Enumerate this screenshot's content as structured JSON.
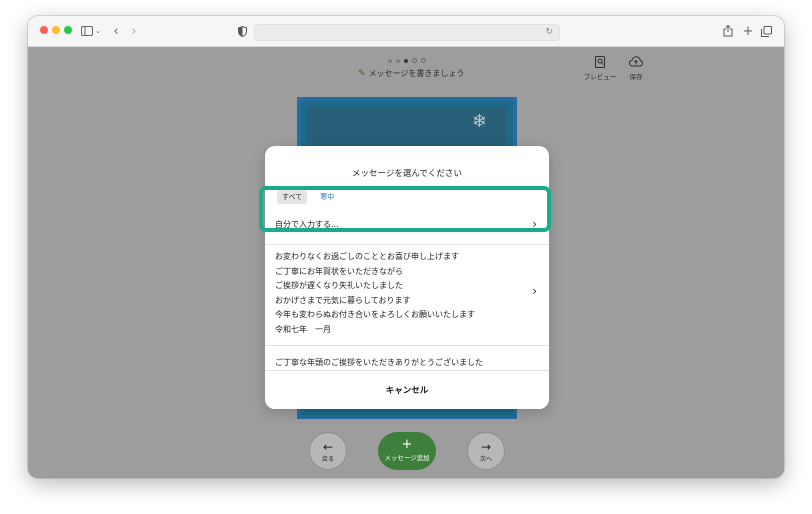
{
  "toolbar": {
    "traffic_lights": [
      "close",
      "minimize",
      "zoom"
    ],
    "icons": [
      "sidebar-icon",
      "chevron-down-icon",
      "back-icon",
      "forward-icon",
      "shield-icon",
      "reload-icon",
      "share-icon",
      "new-tab-icon",
      "tabs-overview-icon"
    ]
  },
  "editor": {
    "step_count": 5,
    "current_step": 3,
    "step_title": "メッセージを書きましょう",
    "tools": [
      {
        "label": "プレビュー",
        "icon": "preview-icon"
      },
      {
        "label": "保存",
        "icon": "cloud-upload-icon"
      }
    ],
    "back_label": "戻る",
    "add_label": "メッセージ追加",
    "next_label": "次へ"
  },
  "card": {
    "colors": {
      "border": "#256ea0",
      "background": "#295f78"
    }
  },
  "modal": {
    "title": "メッセージを選んでください",
    "tabs": [
      {
        "label": "すべて",
        "active": true
      },
      {
        "label": "寒中",
        "active": false
      }
    ],
    "self_input_label": "自分で入力する...",
    "messages": [
      {
        "lines": [
          "お変わりなくお過ごしのこととお喜び申し上げます",
          "ご丁寧にお年賀状をいただきながら",
          "ご挨拶が遅くなり失礼いたしました",
          "おかげさまで元気に暮らしております",
          "今年も変わらぬお付き合いをよろしくお願いいたします",
          "令和七年　一月"
        ]
      },
      {
        "lines": [
          "ご丁寧な年頭のご挨拶をいただきありがとうございました"
        ]
      }
    ],
    "cancel_label": "キャンセル"
  },
  "colors": {
    "highlight": "#18ab8c",
    "accent_green": "#3d7f3b",
    "tab_link": "#2d6fb6",
    "overlay": "#9d9d9d"
  }
}
